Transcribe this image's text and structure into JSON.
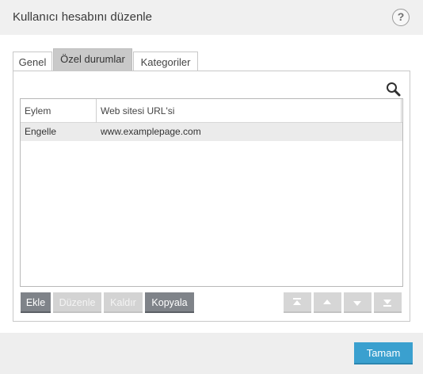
{
  "window": {
    "title": "Kullanıcı hesabını düzenle",
    "help": "?"
  },
  "tabs": [
    {
      "label": "Genel"
    },
    {
      "label": "Özel durumlar"
    },
    {
      "label": "Kategoriler"
    }
  ],
  "table": {
    "columns": [
      "Eylem",
      "Web sitesi URL'si"
    ],
    "rows": [
      {
        "action": "Engelle",
        "url": "www.examplepage.com"
      }
    ]
  },
  "actions": {
    "add": "Ekle",
    "edit": "Düzenle",
    "remove": "Kaldır",
    "copy": "Kopyala"
  },
  "footer": {
    "ok": "Tamam"
  },
  "colors": {
    "primary": "#3aa0cf",
    "active_button": "#7f8389",
    "disabled_button": "#d3d3d3",
    "selected_tab": "#c9c9c9"
  }
}
